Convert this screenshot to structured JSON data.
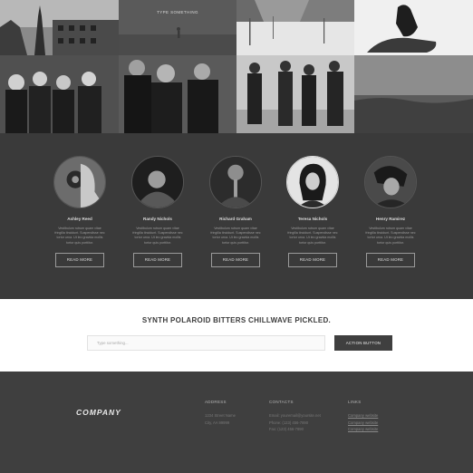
{
  "gallery": {
    "caption": "TYPE SOMETHING"
  },
  "team": {
    "members": [
      {
        "name": "Ashley Reed",
        "bio": "Vestibulum rutrum quam vitae fringilla tincidunt. Suspendisse nec tortor urna. Ut leo gravida mollis tortor quis porttitor."
      },
      {
        "name": "Randy Nichols",
        "bio": "Vestibulum rutrum quam vitae fringilla tincidunt. Suspendisse nec tortor urna. Ut leo gravida mollis tortor quis porttitor."
      },
      {
        "name": "Richard Graham",
        "bio": "Vestibulum rutrum quam vitae fringilla tincidunt. Suspendisse nec tortor urna. Ut leo gravida mollis tortor quis porttitor."
      },
      {
        "name": "Teresa Nichols",
        "bio": "Vestibulum rutrum quam vitae fringilla tincidunt. Suspendisse nec tortor urna. Ut leo gravida mollis tortor quis porttitor."
      },
      {
        "name": "Henry Ramirez",
        "bio": "Vestibulum rutrum quam vitae fringilla tincidunt. Suspendisse nec tortor urna. Ut leo gravida mollis tortor quis porttitor."
      }
    ],
    "read_more_label": "READ MORE"
  },
  "cta": {
    "heading": "SYNTH POLAROID BITTERS CHILLWAVE PICKLED.",
    "input_placeholder": "Type something...",
    "input_value": "",
    "button_label": "ACTION BUTTON"
  },
  "footer": {
    "logo": "COMPANY",
    "address": {
      "heading": "ADDRESS",
      "lines": [
        "1234 Street Name",
        "City, AA 99999"
      ]
    },
    "contacts": {
      "heading": "CONTACTS",
      "lines": [
        "Email: youremail@yoursite.net",
        "Phone: (123) 456-7890",
        "Fax: (123) 456-7890"
      ]
    },
    "links": {
      "heading": "LINKS",
      "items": [
        "Company website",
        "Company website",
        "Company website"
      ]
    }
  },
  "colors": {
    "page_dark": "#3d3d3d",
    "cta_background": "#ffffff",
    "button_dark": "#3f3f3f",
    "text_light": "#dcdcdc"
  }
}
